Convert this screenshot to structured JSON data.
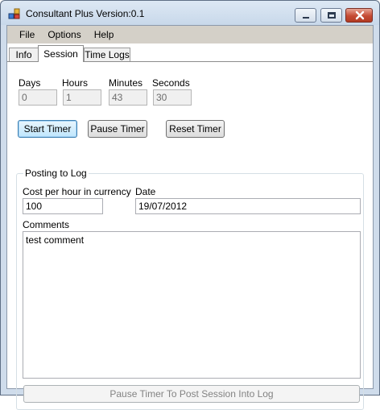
{
  "window": {
    "title": "Consultant Plus Version:0.1",
    "icon": "app-icon",
    "controls": [
      "minimize-icon",
      "maximize-icon",
      "close-icon"
    ]
  },
  "menu": {
    "items": [
      "File",
      "Options",
      "Help"
    ]
  },
  "tabs": [
    {
      "label": "Info",
      "active": false
    },
    {
      "label": "Session",
      "active": true
    },
    {
      "label": "Time Logs",
      "active": false
    }
  ],
  "timer": {
    "days_label": "Days",
    "hours_label": "Hours",
    "minutes_label": "Minutes",
    "seconds_label": "Seconds",
    "days": "0",
    "hours": "1",
    "minutes": "43",
    "seconds": "30"
  },
  "buttons": {
    "start": "Start Timer",
    "pause": "Pause Timer",
    "reset": "Reset Timer"
  },
  "posting": {
    "group_title": "Posting to Log",
    "cost_label": "Cost per hour in currency",
    "cost_value": "100",
    "date_label": "Date",
    "date_value": "19/07/2012",
    "comments_label": "Comments",
    "comments_value": "test comment",
    "post_button": "Pause Timer To Post Session Into Log"
  }
}
